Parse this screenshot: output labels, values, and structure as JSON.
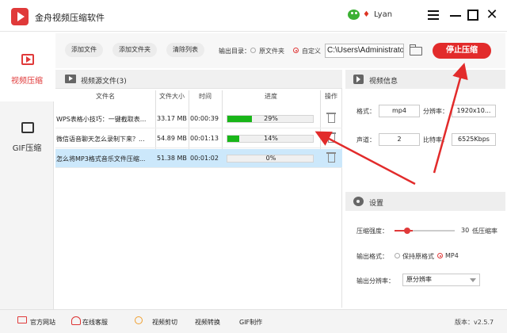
{
  "app": {
    "title": "金舟视频压缩软件",
    "user": "Lyan"
  },
  "sidebar": {
    "items": [
      {
        "label": "视频压缩"
      },
      {
        "label": "GIF压缩"
      }
    ]
  },
  "toolbar": {
    "add_file": "添加文件",
    "add_folder": "添加文件夹",
    "clear_list": "清除列表",
    "output_label": "输出目录：",
    "opt_source": "原文件夹",
    "opt_custom": "自定义",
    "output_path": "C:\\Users\\Administrator\\",
    "stop_button": "停止压缩"
  },
  "file_list": {
    "title": "视频源文件(3)",
    "columns": [
      "文件名",
      "文件大小",
      "时间",
      "进度",
      "操作"
    ],
    "rows": [
      {
        "name": "WPS表格小技巧：一键截取表...",
        "size": "33.17 MB",
        "time": "00:00:39",
        "progress": 29,
        "progress_text": "29%"
      },
      {
        "name": "微信语音聊天怎么录制下来？...",
        "size": "54.89 MB",
        "time": "00:01:13",
        "progress": 14,
        "progress_text": "14%"
      },
      {
        "name": "怎么将MP3格式音乐文件压缩...",
        "size": "51.38 MB",
        "time": "00:01:02",
        "progress": 0,
        "progress_text": "0%"
      }
    ]
  },
  "video_info": {
    "title": "视频信息",
    "format_label": "格式：",
    "format": "mp4",
    "resolution_label": "分辨率：",
    "resolution": "1920x10...",
    "channel_label": "声道：",
    "channel": "2",
    "bitrate_label": "比特率：",
    "bitrate": "6525Kbps"
  },
  "settings": {
    "title": "设置",
    "strength_label": "压缩强度：",
    "strength_value": 30,
    "strength_value_text": "30",
    "strength_hint": "低压缩率",
    "out_format_label": "输出格式：",
    "opt_keep": "保持原格式",
    "opt_mp4": "MP4",
    "out_res_label": "输出分辨率：",
    "out_res_value": "原分辨率"
  },
  "footer": {
    "website": "官方网站",
    "support": "在线客服",
    "cut": "视频剪切",
    "convert": "视频转换",
    "gif": "GIF制作",
    "version": "版本：v2.5.7"
  },
  "colors": {
    "accent": "#e22b2b",
    "progress": "#19b619",
    "selected_row": "#cce8fb"
  }
}
